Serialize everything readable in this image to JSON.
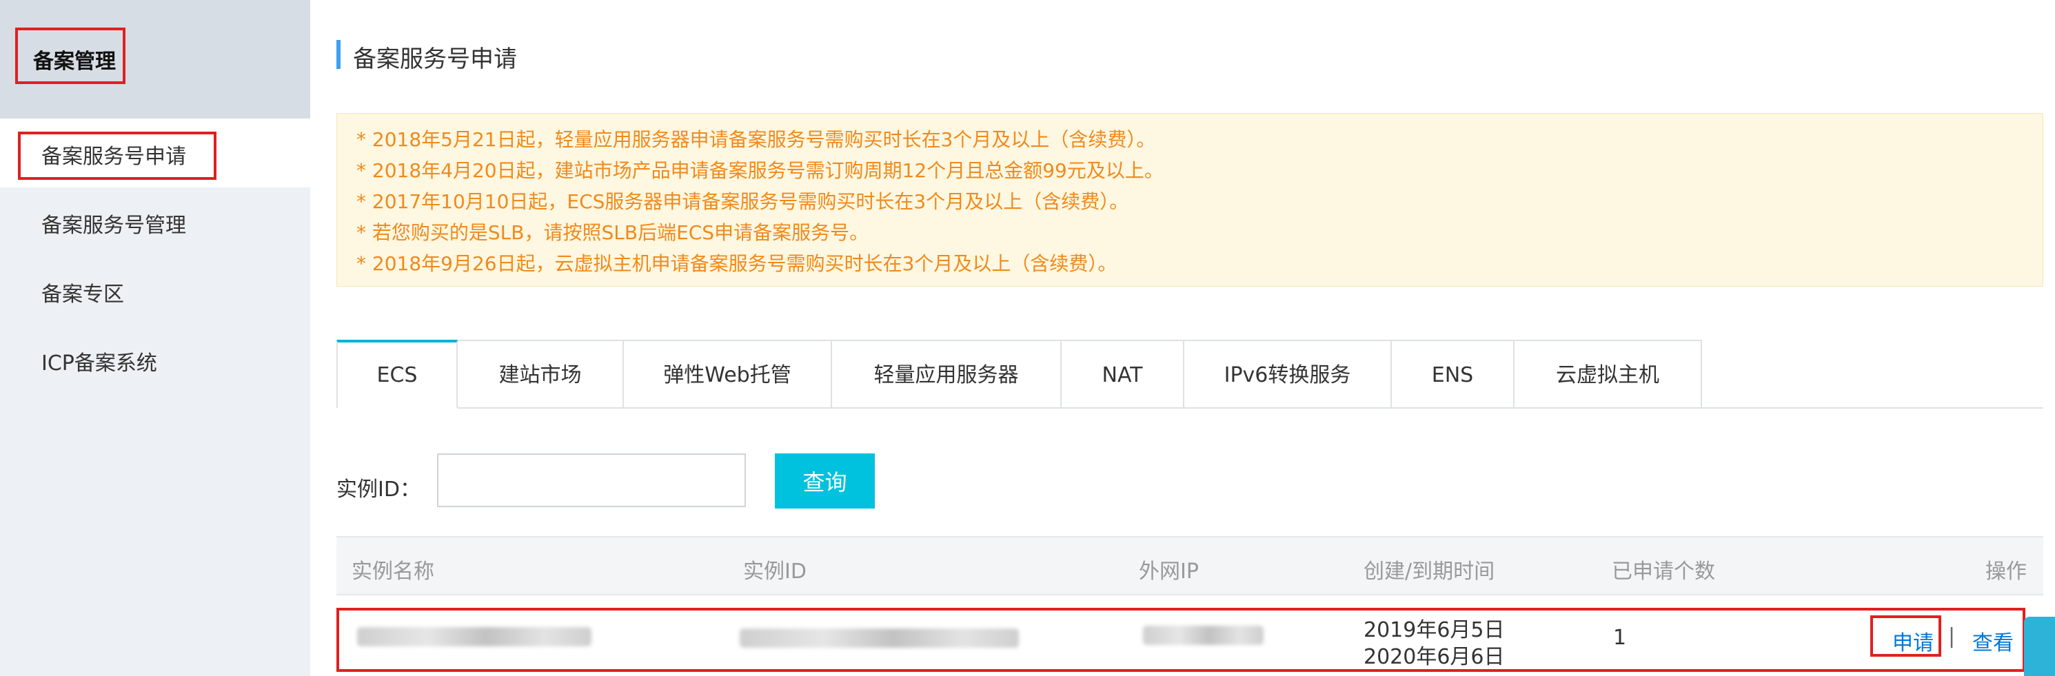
{
  "sidebar": {
    "title": "备案管理",
    "items": [
      {
        "label": "备案服务号申请",
        "active": true
      },
      {
        "label": "备案服务号管理",
        "active": false
      },
      {
        "label": "备案专区",
        "active": false
      },
      {
        "label": "ICP备案系统",
        "active": false
      }
    ]
  },
  "main": {
    "title": "备案服务号申请",
    "notices": [
      "* 2018年5月21日起，轻量应用服务器申请备案服务号需购买时长在3个月及以上（含续费）。",
      "* 2018年4月20日起，建站市场产品申请备案服务号需订购周期12个月且总金额99元及以上。",
      "* 2017年10月10日起，ECS服务器申请备案服务号需购买时长在3个月及以上（含续费）。",
      "* 若您购买的是SLB，请按照SLB后端ECS申请备案服务号。",
      "* 2018年9月26日起，云虚拟主机申请备案服务号需购买时长在3个月及以上（含续费）。"
    ],
    "tabs": [
      {
        "label": "ECS",
        "active": true
      },
      {
        "label": "建站市场",
        "active": false
      },
      {
        "label": "弹性Web托管",
        "active": false
      },
      {
        "label": "轻量应用服务器",
        "active": false
      },
      {
        "label": "NAT",
        "active": false
      },
      {
        "label": "IPv6转换服务",
        "active": false
      },
      {
        "label": "ENS",
        "active": false
      },
      {
        "label": "云虚拟主机",
        "active": false
      }
    ],
    "search": {
      "label": "实例ID：",
      "value": "",
      "placeholder": "",
      "button_label": "查询"
    },
    "table": {
      "columns": [
        "实例名称",
        "实例ID",
        "外网IP",
        "创建/到期时间",
        "已申请个数",
        "操作"
      ],
      "rows": [
        {
          "created": "2019年6月5日",
          "expires": "2020年6月6日",
          "applied_count": "1",
          "action_apply": "申请",
          "action_separator": "|",
          "action_view": "查看"
        }
      ]
    }
  },
  "colors": {
    "accent": "#00c1de",
    "tab_active": "#00b1dc",
    "notice_text": "#f08a1c",
    "notice_bg": "#fef7e1",
    "link": "#0077d8",
    "highlight": "#e02020"
  }
}
